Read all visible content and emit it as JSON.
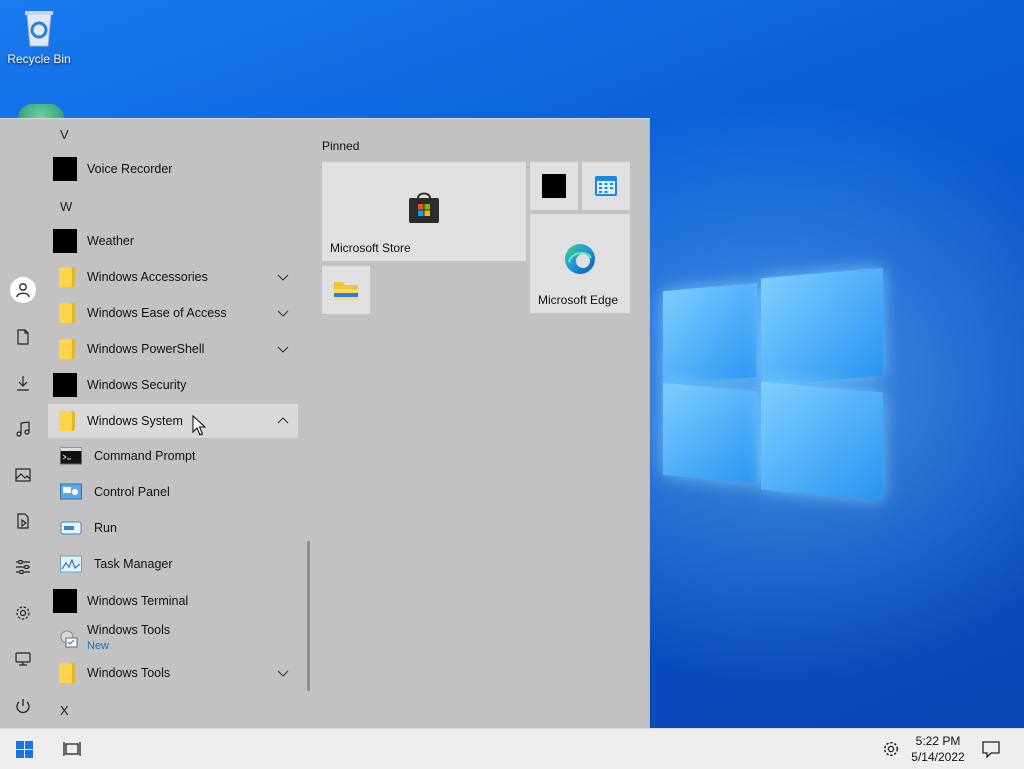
{
  "desktop": {
    "recycle_bin_label": "Recycle Bin"
  },
  "start_menu": {
    "rail_icons": [
      "user-icon",
      "documents-icon",
      "downloads-icon",
      "music-icon",
      "pictures-icon",
      "videos-icon",
      "personalization-icon",
      "settings-icon",
      "network-icon",
      "power-icon"
    ],
    "letters": {
      "v": "V",
      "w": "W",
      "x": "X"
    },
    "apps": {
      "voice_recorder": "Voice Recorder",
      "weather": "Weather",
      "windows_accessories": "Windows Accessories",
      "windows_ease_of_access": "Windows Ease of Access",
      "windows_powershell": "Windows PowerShell",
      "windows_security": "Windows Security",
      "windows_system": "Windows System",
      "command_prompt": "Command Prompt",
      "control_panel": "Control Panel",
      "run": "Run",
      "task_manager": "Task Manager",
      "windows_terminal": "Windows Terminal",
      "windows_tools_new": "Windows Tools",
      "new_badge": "New",
      "windows_tools_folder": "Windows Tools"
    },
    "pinned": {
      "title": "Pinned",
      "microsoft_store": "Microsoft Store",
      "microsoft_edge": "Microsoft Edge"
    }
  },
  "taskbar": {
    "time": "5:22 PM",
    "date": "5/14/2022"
  },
  "colors": {
    "accent": "#0a63d8",
    "menu_bg": "#c2c2c2",
    "selected_row": "#d9d9d9",
    "new_badge": "#1f6fbf"
  }
}
